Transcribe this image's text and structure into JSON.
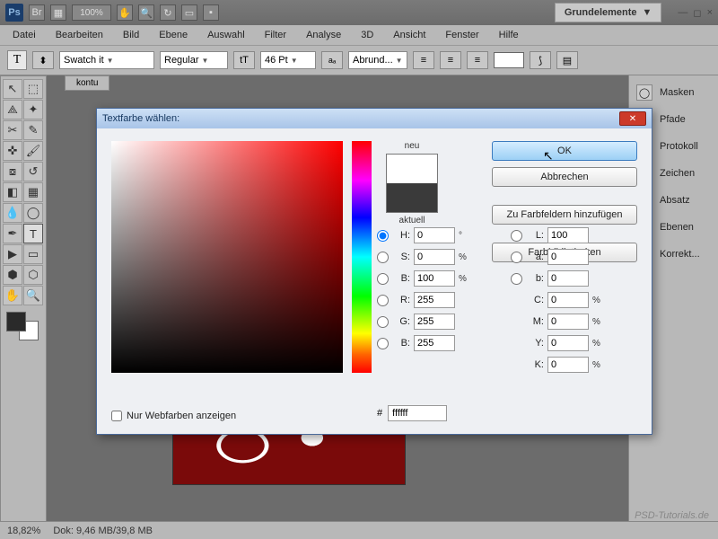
{
  "titlebar": {
    "workspace": "Grundelemente"
  },
  "menu": [
    "Datei",
    "Bearbeiten",
    "Bild",
    "Ebene",
    "Auswahl",
    "Filter",
    "Analyse",
    "3D",
    "Ansicht",
    "Fenster",
    "Hilfe"
  ],
  "optbar": {
    "font": "Swatch it",
    "style": "Regular",
    "size": "46 Pt",
    "aa": "Abrund..."
  },
  "tab": "kontu",
  "panels": [
    "Masken",
    "Pfade",
    "Protokoll",
    "Zeichen",
    "Absatz",
    "Ebenen",
    "Korrekt..."
  ],
  "status": {
    "zoom": "18,82%",
    "doc": "Dok: 9,46 MB/39,8 MB"
  },
  "watermark": "PSD-Tutorials.de",
  "dialog": {
    "title": "Textfarbe wählen:",
    "new_label": "neu",
    "current_label": "aktuell",
    "btn_ok": "OK",
    "btn_cancel": "Abbrechen",
    "btn_add": "Zu Farbfeldern hinzufügen",
    "btn_lib": "Farbbibliotheken",
    "H": "0",
    "S": "0",
    "B": "100",
    "R": "255",
    "G": "255",
    "Bb": "255",
    "L": "100",
    "a": "0",
    "b": "0",
    "C": "0",
    "M": "0",
    "Y": "0",
    "K": "0",
    "hex": "ffffff",
    "webonly": "Nur Webfarben anzeigen"
  }
}
